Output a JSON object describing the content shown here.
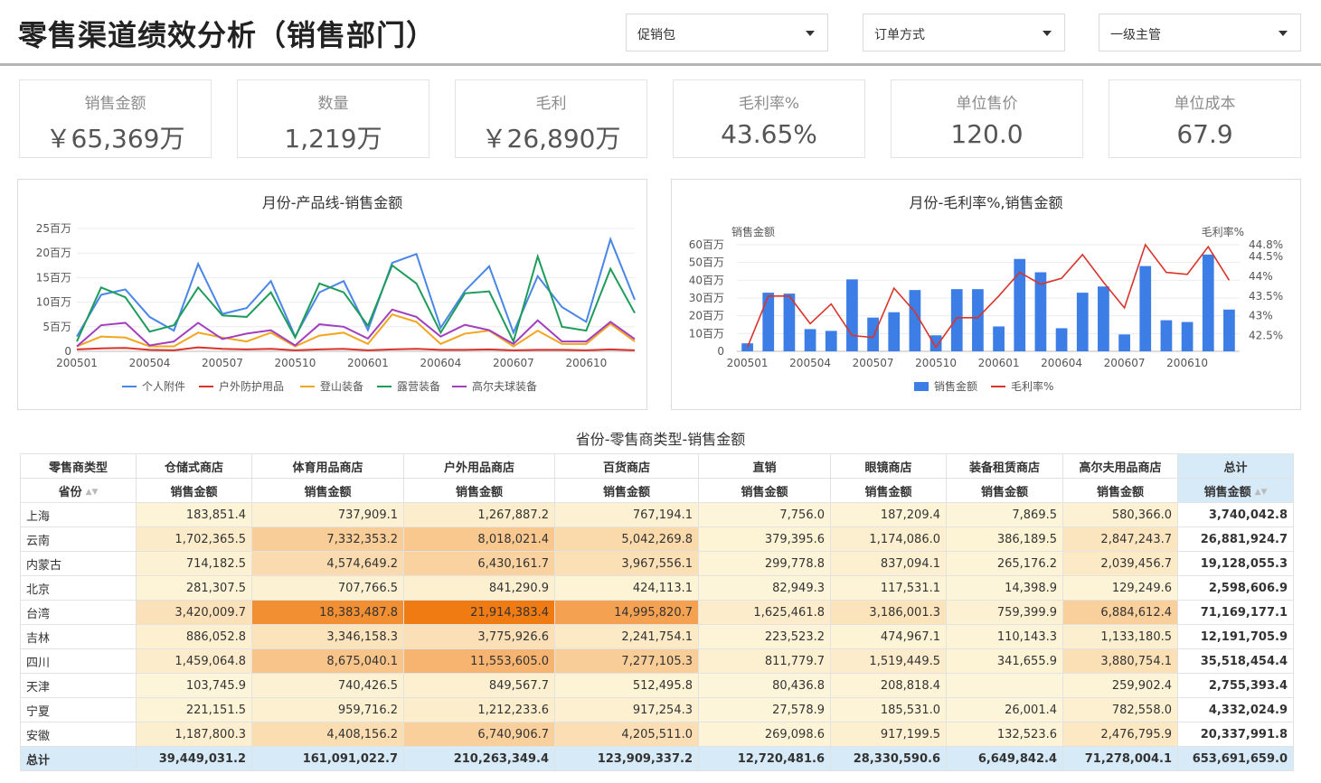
{
  "header": {
    "title": "零售渠道绩效分析（销售部门）",
    "filters": [
      "促销包",
      "订单方式",
      "一级主管"
    ]
  },
  "kpis": [
    {
      "label": "销售金额",
      "value": "￥65,369万"
    },
    {
      "label": "数量",
      "value": "1,219万"
    },
    {
      "label": "毛利",
      "value": "￥26,890万"
    },
    {
      "label": "毛利率%",
      "value": "43.65%"
    },
    {
      "label": "单位售价",
      "value": "120.0"
    },
    {
      "label": "单位成本",
      "value": "67.9"
    }
  ],
  "colors": {
    "series": [
      "#4a86e8",
      "#d9342b",
      "#f2a51e",
      "#1e9c5a",
      "#a23fbf"
    ],
    "bar": "#3d7ee6",
    "heat_low": "#fdf5d9",
    "heat_high": "#f07b12",
    "total_bg": "#d7eaf7"
  },
  "chart_data": [
    {
      "type": "line",
      "title": "月份-产品线-销售金额",
      "x": [
        "200501",
        "200502",
        "200503",
        "200504",
        "200505",
        "200506",
        "200507",
        "200508",
        "200509",
        "200510",
        "200511",
        "200512",
        "200601",
        "200602",
        "200603",
        "200604",
        "200605",
        "200606",
        "200607",
        "200608",
        "200609",
        "200610",
        "200611",
        "200612"
      ],
      "x_ticks": [
        "200501",
        "200504",
        "200507",
        "200510",
        "200601",
        "200604",
        "200607",
        "200610"
      ],
      "y_ticks": [
        "0",
        "5百万",
        "10百万",
        "15百万",
        "20百万",
        "25百万"
      ],
      "ylim": [
        0,
        25
      ],
      "y_unit": "百万",
      "series": [
        {
          "name": "个人附件",
          "values": [
            3.0,
            11.5,
            12.6,
            7.0,
            4.2,
            17.8,
            7.6,
            8.8,
            14.3,
            3.0,
            12.0,
            14.3,
            4.3,
            18.0,
            19.8,
            4.8,
            12.3,
            17.3,
            3.8,
            15.3,
            9.0,
            6.0,
            22.8,
            10.5
          ]
        },
        {
          "name": "户外防护用品",
          "values": [
            0.4,
            0.6,
            0.7,
            0.3,
            0.2,
            0.8,
            0.5,
            0.4,
            0.5,
            0.2,
            0.4,
            0.5,
            0.2,
            0.4,
            0.5,
            0.3,
            0.3,
            0.4,
            0.2,
            0.3,
            0.3,
            0.2,
            0.4,
            0.2
          ]
        },
        {
          "name": "登山装备",
          "values": [
            1.0,
            3.0,
            2.8,
            1.0,
            1.0,
            3.8,
            2.8,
            2.0,
            3.8,
            1.0,
            3.2,
            3.8,
            1.5,
            7.5,
            6.0,
            1.5,
            3.6,
            4.2,
            1.0,
            4.2,
            1.5,
            1.5,
            5.6,
            2.0
          ]
        },
        {
          "name": "露营装备",
          "values": [
            2.0,
            13.0,
            11.0,
            4.0,
            5.3,
            13.0,
            7.3,
            7.0,
            12.0,
            2.8,
            13.8,
            12.0,
            5.2,
            17.5,
            13.8,
            3.8,
            11.8,
            12.2,
            2.0,
            19.3,
            5.0,
            4.2,
            16.8,
            7.8
          ]
        },
        {
          "name": "高尔夫球装备",
          "values": [
            1.0,
            5.3,
            5.8,
            1.2,
            2.0,
            5.8,
            2.5,
            3.6,
            4.3,
            1.2,
            5.5,
            5.0,
            2.6,
            8.5,
            7.0,
            3.0,
            5.4,
            4.3,
            1.5,
            6.3,
            2.0,
            2.0,
            6.0,
            2.5
          ]
        }
      ]
    },
    {
      "type": "bar",
      "title": "月份-毛利率%,销售金额",
      "x": [
        "200501",
        "200502",
        "200503",
        "200504",
        "200505",
        "200506",
        "200507",
        "200508",
        "200509",
        "200510",
        "200511",
        "200512",
        "200601",
        "200602",
        "200603",
        "200604",
        "200605",
        "200606",
        "200607",
        "200608",
        "200609",
        "200610",
        "200611",
        "200612"
      ],
      "x_ticks": [
        "200501",
        "200504",
        "200507",
        "200510",
        "200601",
        "200604",
        "200607",
        "200610"
      ],
      "ylabel": "销售金额",
      "y2label": "毛利率%",
      "y_ticks": [
        "0",
        "10百万",
        "20百万",
        "30百万",
        "40百万",
        "50百万",
        "60百万"
      ],
      "y2_ticks": [
        "42.5%",
        "43%",
        "43.5%",
        "44%",
        "44.5%",
        "44.8%"
      ],
      "ylim": [
        0,
        60
      ],
      "y2lim": [
        42.1,
        44.8
      ],
      "series": [
        {
          "name": "销售金额",
          "type": "bar",
          "values": [
            4.5,
            33,
            32.5,
            12.5,
            11.5,
            40.5,
            19,
            22,
            34.5,
            9,
            35,
            35,
            14,
            52,
            44.5,
            13,
            33,
            36.5,
            9.5,
            48,
            17.5,
            16.5,
            54.5,
            23.5
          ]
        },
        {
          "name": "毛利率%",
          "type": "line",
          "values": [
            42.2,
            43.5,
            43.5,
            42.8,
            43.3,
            42.5,
            42.45,
            43.7,
            43.1,
            42.2,
            42.95,
            42.95,
            43.5,
            44.1,
            43.8,
            43.95,
            44.55,
            43.85,
            43.2,
            44.8,
            44.1,
            44.05,
            44.75,
            43.9
          ]
        }
      ]
    }
  ],
  "table": {
    "title": "省份-零售商类型-销售金额",
    "corner_label": "零售商类型",
    "row_header": "省份",
    "columns": [
      "仓储式商店",
      "体育用品商店",
      "户外用品商店",
      "百货商店",
      "直销",
      "眼镜商店",
      "装备租赁商店",
      "高尔夫用品商店",
      "总计"
    ],
    "measure": "销售金额",
    "rows": [
      {
        "name": "上海",
        "values": [
          "183,851.4",
          "737,909.1",
          "1,267,887.2",
          "767,194.1",
          "7,756.0",
          "187,209.4",
          "7,869.5",
          "580,366.0",
          "3,740,042.8"
        ],
        "heat": [
          0.01,
          0.03,
          0.06,
          0.03,
          0.0,
          0.01,
          0.0,
          0.03
        ]
      },
      {
        "name": "云南",
        "values": [
          "1,702,365.5",
          "7,332,353.2",
          "8,018,021.4",
          "5,042,269.8",
          "379,395.6",
          "1,174,086.0",
          "386,189.5",
          "2,847,243.7",
          "26,881,924.7"
        ],
        "heat": [
          0.08,
          0.33,
          0.37,
          0.23,
          0.02,
          0.05,
          0.02,
          0.13
        ]
      },
      {
        "name": "内蒙古",
        "values": [
          "714,182.5",
          "4,574,649.2",
          "6,430,161.7",
          "3,967,556.1",
          "299,778.8",
          "837,094.1",
          "265,176.2",
          "2,039,456.7",
          "19,128,055.3"
        ],
        "heat": [
          0.03,
          0.21,
          0.29,
          0.18,
          0.01,
          0.04,
          0.01,
          0.09
        ]
      },
      {
        "name": "北京",
        "values": [
          "281,307.5",
          "707,766.5",
          "841,290.9",
          "424,113.1",
          "82,949.3",
          "117,531.1",
          "14,398.9",
          "129,249.6",
          "2,598,606.9"
        ],
        "heat": [
          0.01,
          0.03,
          0.04,
          0.02,
          0.0,
          0.01,
          0.0,
          0.01
        ]
      },
      {
        "name": "台湾",
        "values": [
          "3,420,009.7",
          "18,383,487.8",
          "21,914,383.4",
          "14,995,820.7",
          "1,625,461.8",
          "3,186,001.3",
          "759,399.9",
          "6,884,612.4",
          "71,169,177.1"
        ],
        "heat": [
          0.16,
          0.84,
          1.0,
          0.68,
          0.07,
          0.15,
          0.03,
          0.31
        ]
      },
      {
        "name": "吉林",
        "values": [
          "886,052.8",
          "3,346,158.3",
          "3,775,926.6",
          "2,241,754.1",
          "223,523.2",
          "474,967.1",
          "110,143.3",
          "1,133,180.5",
          "12,191,705.9"
        ],
        "heat": [
          0.04,
          0.15,
          0.17,
          0.1,
          0.01,
          0.02,
          0.01,
          0.05
        ]
      },
      {
        "name": "四川",
        "values": [
          "1,459,064.8",
          "8,675,040.1",
          "11,553,605.0",
          "7,277,105.3",
          "811,779.7",
          "1,519,449.5",
          "341,655.9",
          "3,880,754.1",
          "35,518,454.4"
        ],
        "heat": [
          0.07,
          0.4,
          0.53,
          0.33,
          0.04,
          0.07,
          0.02,
          0.18
        ]
      },
      {
        "name": "天津",
        "values": [
          "103,745.9",
          "740,426.5",
          "849,567.7",
          "512,495.8",
          "80,436.8",
          "208,818.4",
          "",
          "259,902.4",
          "2,755,393.4"
        ],
        "heat": [
          0.0,
          0.03,
          0.04,
          0.02,
          0.0,
          0.01,
          null,
          0.01
        ]
      },
      {
        "name": "宁夏",
        "values": [
          "221,151.5",
          "959,716.2",
          "1,212,233.6",
          "917,254.3",
          "27,578.9",
          "185,531.0",
          "26,001.4",
          "782,558.0",
          "4,332,024.9"
        ],
        "heat": [
          0.01,
          0.04,
          0.06,
          0.04,
          0.0,
          0.01,
          0.0,
          0.04
        ]
      },
      {
        "name": "安徽",
        "values": [
          "1,187,800.3",
          "4,408,156.2",
          "6,740,906.7",
          "4,205,511.0",
          "269,098.6",
          "917,199.5",
          "132,523.6",
          "2,476,795.9",
          "20,337,991.8"
        ],
        "heat": [
          0.05,
          0.2,
          0.31,
          0.19,
          0.01,
          0.04,
          0.01,
          0.11
        ]
      }
    ],
    "total_row": {
      "name": "总计",
      "values": [
        "39,449,031.2",
        "161,091,022.7",
        "210,263,349.4",
        "123,909,337.2",
        "12,720,481.6",
        "28,330,590.6",
        "6,649,842.4",
        "71,278,004.1",
        "653,691,659.0"
      ]
    }
  }
}
